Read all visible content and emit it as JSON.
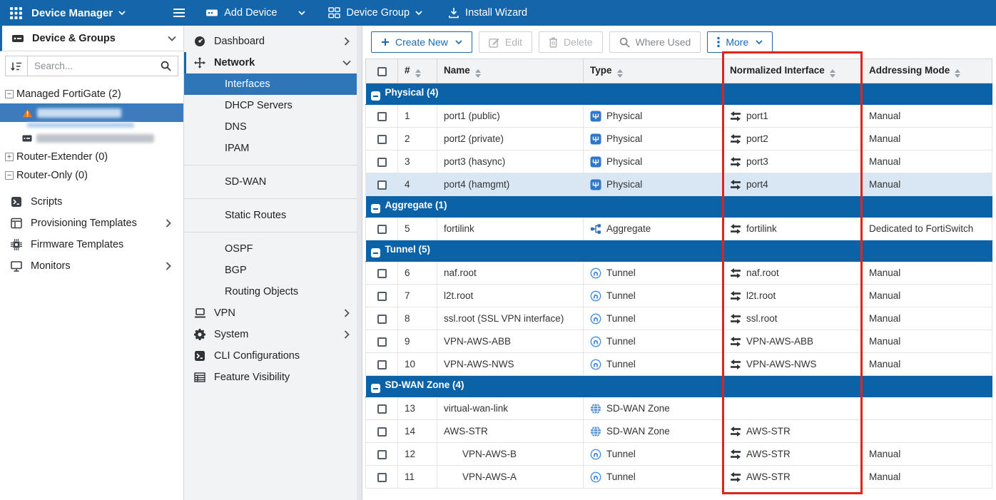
{
  "topbar": {
    "app_title": "Device Manager",
    "add_device": "Add Device",
    "device_group": "Device Group",
    "install_wizard": "Install Wizard"
  },
  "device_panel": {
    "header": "Device & Groups",
    "search_placeholder": "Search...",
    "tree": [
      {
        "label": "Managed FortiGate (2)",
        "expander": "minus"
      },
      {
        "redacted": true,
        "selected": true,
        "icon": "warning",
        "substrip": true
      },
      {
        "redacted": true,
        "icon": "device"
      },
      {
        "label": "Router-Extender (0)",
        "expander": "plus"
      },
      {
        "label": "Router-Only (0)",
        "expander": "minus"
      }
    ],
    "items": [
      {
        "label": "Scripts",
        "icon": "scripts"
      },
      {
        "label": "Provisioning Templates",
        "icon": "provisioning",
        "chevron": true
      },
      {
        "label": "Firmware Templates",
        "icon": "firmware"
      },
      {
        "label": "Monitors",
        "icon": "monitors",
        "chevron": true
      }
    ]
  },
  "nav_menu": {
    "items": [
      {
        "label": "Dashboard",
        "icon": "dashboard",
        "chevron": "right"
      },
      {
        "label": "Network",
        "icon": "network",
        "chevron": "down",
        "bold": true,
        "accent": true
      },
      {
        "label": "Interfaces",
        "sub": true,
        "selected": true
      },
      {
        "label": "DHCP Servers",
        "sub": true
      },
      {
        "label": "DNS",
        "sub": true
      },
      {
        "label": "IPAM",
        "sub": true
      },
      {
        "divider": true
      },
      {
        "label": "SD-WAN",
        "sub": true
      },
      {
        "divider": true
      },
      {
        "label": "Static Routes",
        "sub": true
      },
      {
        "divider": true
      },
      {
        "label": "OSPF",
        "sub": true
      },
      {
        "label": "BGP",
        "sub": true
      },
      {
        "label": "Routing Objects",
        "sub": true
      },
      {
        "label": "VPN",
        "icon": "vpn",
        "chevron": "right"
      },
      {
        "label": "System",
        "icon": "system",
        "chevron": "right"
      },
      {
        "label": "CLI Configurations",
        "icon": "cli"
      },
      {
        "label": "Feature Visibility",
        "icon": "feature"
      }
    ]
  },
  "toolbar": {
    "buttons": [
      {
        "label": "Create New",
        "icon": "plus",
        "caret": true,
        "style": "primary"
      },
      {
        "label": "Edit",
        "icon": "edit",
        "style": "disabled"
      },
      {
        "label": "Delete",
        "icon": "trash",
        "style": "disabled"
      },
      {
        "label": "Where Used",
        "icon": "search",
        "style": "muted"
      },
      {
        "label": "More",
        "icon": "dots",
        "caret": true,
        "style": "primary"
      }
    ]
  },
  "table": {
    "headers": [
      "#",
      "Name",
      "Type",
      "Normalized Interface",
      "Addressing Mode"
    ],
    "groups": [
      {
        "label": "Physical (4)",
        "rows": [
          {
            "num": "1",
            "name": "port1 (public)",
            "type": "Physical",
            "type_icon": "physical",
            "norm": "port1",
            "mode": "Manual"
          },
          {
            "num": "2",
            "name": "port2 (private)",
            "type": "Physical",
            "type_icon": "physical",
            "norm": "port2",
            "mode": "Manual"
          },
          {
            "num": "3",
            "name": "port3 (hasync)",
            "type": "Physical",
            "type_icon": "physical",
            "norm": "port3",
            "mode": "Manual"
          },
          {
            "num": "4",
            "name": "port4 (hamgmt)",
            "type": "Physical",
            "type_icon": "physical",
            "norm": "port4",
            "mode": "Manual",
            "selected": true
          }
        ]
      },
      {
        "label": "Aggregate (1)",
        "rows": [
          {
            "num": "5",
            "name": "fortilink",
            "type": "Aggregate",
            "type_icon": "aggregate",
            "norm": "fortilink",
            "mode": "Dedicated to FortiSwitch"
          }
        ]
      },
      {
        "label": "Tunnel (5)",
        "rows": [
          {
            "num": "6",
            "name": "naf.root",
            "type": "Tunnel",
            "type_icon": "tunnel",
            "norm": "naf.root",
            "mode": "Manual"
          },
          {
            "num": "7",
            "name": "l2t.root",
            "type": "Tunnel",
            "type_icon": "tunnel",
            "norm": "l2t.root",
            "mode": "Manual"
          },
          {
            "num": "8",
            "name": "ssl.root (SSL VPN interface)",
            "type": "Tunnel",
            "type_icon": "tunnel",
            "norm": "ssl.root",
            "mode": "Manual"
          },
          {
            "num": "9",
            "name": "VPN-AWS-ABB",
            "type": "Tunnel",
            "type_icon": "tunnel",
            "norm": "VPN-AWS-ABB",
            "mode": "Manual"
          },
          {
            "num": "10",
            "name": "VPN-AWS-NWS",
            "type": "Tunnel",
            "type_icon": "tunnel",
            "norm": "VPN-AWS-NWS",
            "mode": "Manual"
          }
        ]
      },
      {
        "label": "SD-WAN Zone (4)",
        "rows": [
          {
            "num": "13",
            "name": "virtual-wan-link",
            "type": "SD-WAN Zone",
            "type_icon": "sdwan",
            "norm": "",
            "mode": ""
          },
          {
            "num": "14",
            "name": "AWS-STR",
            "type": "SD-WAN Zone",
            "type_icon": "sdwan",
            "norm": "AWS-STR",
            "mode": ""
          },
          {
            "num": "12",
            "name": "VPN-AWS-B",
            "indent": true,
            "type": "Tunnel",
            "type_icon": "tunnel",
            "norm": "AWS-STR",
            "mode": "Manual"
          },
          {
            "num": "11",
            "name": "VPN-AWS-A",
            "indent": true,
            "type": "Tunnel",
            "type_icon": "tunnel",
            "norm": "AWS-STR",
            "mode": "Manual"
          }
        ]
      }
    ]
  },
  "colors": {
    "topbar": "#1565ab",
    "group_row": "#0c62a6",
    "selection": "#3d7bbd",
    "menu_selection": "#2f76b8",
    "row_selection": "#d9e7f5",
    "annotation_red": "#df2420",
    "accent_blue": "#176bb3"
  }
}
